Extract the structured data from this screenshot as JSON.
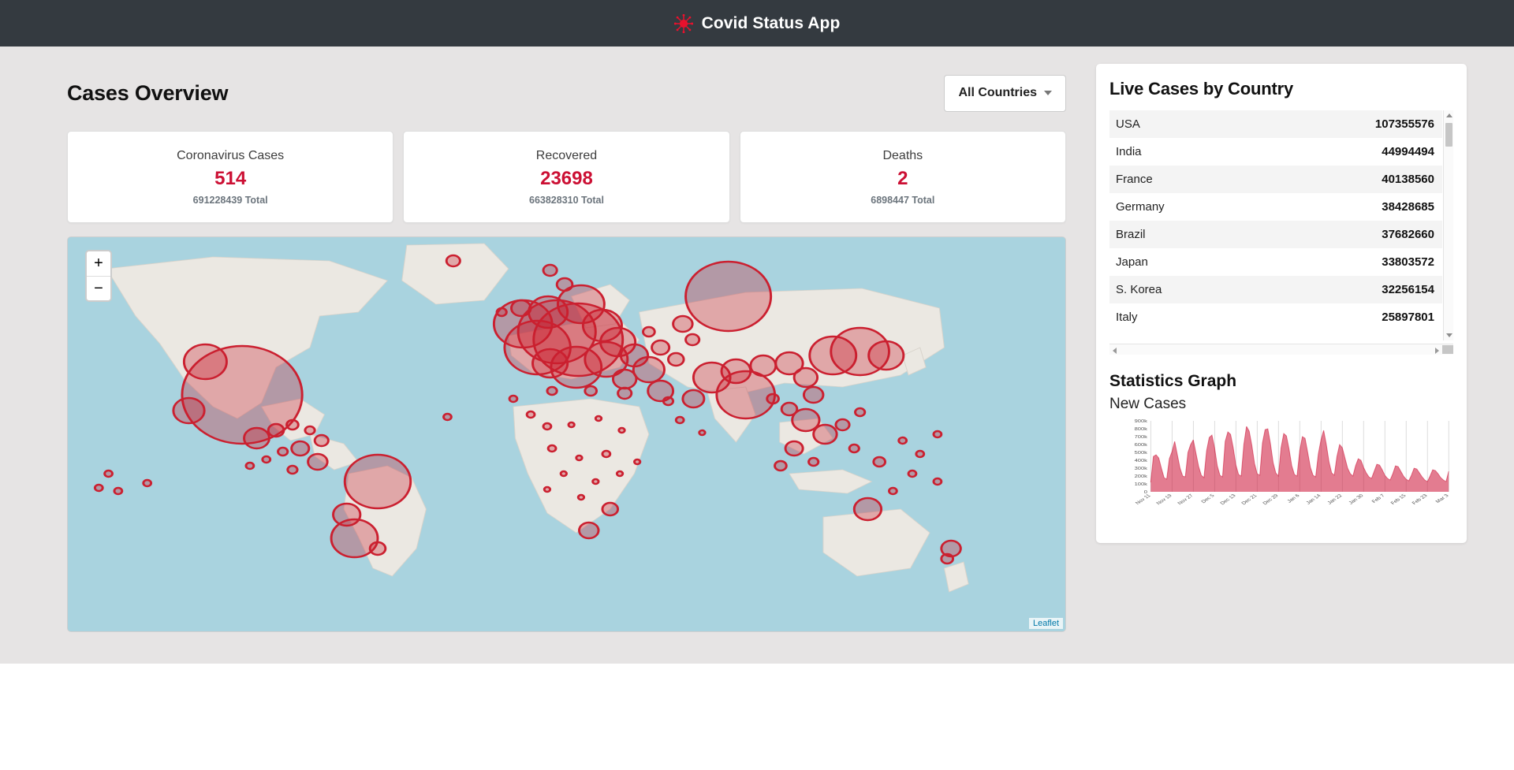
{
  "header": {
    "title": "Covid Status App",
    "icon": "virus-icon",
    "bg_color": "#343a40"
  },
  "overview": {
    "page_title": "Cases Overview",
    "country_dropdown": {
      "selected": "All Countries",
      "icon": "chevron-down-icon"
    },
    "stats": [
      {
        "label": "Coronavirus Cases",
        "value": "514",
        "total": "691228439 Total"
      },
      {
        "label": "Recovered",
        "value": "23698",
        "total": "663828310 Total"
      },
      {
        "label": "Deaths",
        "value": "2",
        "total": "6898447 Total"
      }
    ],
    "accent_color": "#cc1034"
  },
  "map": {
    "zoom_in_label": "+",
    "zoom_out_label": "−",
    "attribution": "Leaflet",
    "water_color": "#a9d3df",
    "land_color": "#ebe8e2",
    "marker_stroke": "#cb2030",
    "marker_fill": "#cb2030"
  },
  "sidebar": {
    "live_cases_title": "Live Cases by Country",
    "countries": [
      {
        "name": "USA",
        "cases": "107355576"
      },
      {
        "name": "India",
        "cases": "44994494"
      },
      {
        "name": "France",
        "cases": "40138560"
      },
      {
        "name": "Germany",
        "cases": "38428685"
      },
      {
        "name": "Brazil",
        "cases": "37682660"
      },
      {
        "name": "Japan",
        "cases": "33803572"
      },
      {
        "name": "S. Korea",
        "cases": "32256154"
      },
      {
        "name": "Italy",
        "cases": "25897801"
      }
    ],
    "statistics_title": "Statistics Graph",
    "statistics_subtitle": "New Cases"
  },
  "chart_data": {
    "type": "area",
    "title": "Statistics Graph",
    "subtitle": "New Cases",
    "xlabel": "",
    "ylabel": "",
    "ylim": [
      0,
      900000
    ],
    "grid": true,
    "legend": false,
    "line_color": "#cc1034",
    "fill_color": "rgba(204,16,52,0.55)",
    "ytick_labels": [
      "0",
      "100k",
      "200k",
      "300k",
      "400k",
      "500k",
      "600k",
      "700k",
      "800k",
      "900k"
    ],
    "ytick_values": [
      0,
      100000,
      200000,
      300000,
      400000,
      500000,
      600000,
      700000,
      800000,
      900000
    ],
    "xtick_labels": [
      "Nov 11",
      "Nov 19",
      "Nov 27",
      "Dec 5",
      "Dec 13",
      "Dec 21",
      "Dec 29",
      "Jan 6",
      "Jan 14",
      "Jan 22",
      "Jan 30",
      "Feb 7",
      "Feb 15",
      "Feb 23",
      "Mar 3"
    ],
    "categories": [
      "Nov 11",
      "Nov 12",
      "Nov 13",
      "Nov 14",
      "Nov 15",
      "Nov 16",
      "Nov 17",
      "Nov 18",
      "Nov 19",
      "Nov 20",
      "Nov 21",
      "Nov 22",
      "Nov 23",
      "Nov 24",
      "Nov 25",
      "Nov 26",
      "Nov 27",
      "Nov 28",
      "Nov 29",
      "Nov 30",
      "Dec 1",
      "Dec 2",
      "Dec 3",
      "Dec 4",
      "Dec 5",
      "Dec 6",
      "Dec 7",
      "Dec 8",
      "Dec 9",
      "Dec 10",
      "Dec 11",
      "Dec 12",
      "Dec 13",
      "Dec 14",
      "Dec 15",
      "Dec 16",
      "Dec 17",
      "Dec 18",
      "Dec 19",
      "Dec 20",
      "Dec 21",
      "Dec 22",
      "Dec 23",
      "Dec 24",
      "Dec 25",
      "Dec 26",
      "Dec 27",
      "Dec 28",
      "Dec 29",
      "Dec 30",
      "Dec 31",
      "Jan 1",
      "Jan 2",
      "Jan 3",
      "Jan 4",
      "Jan 5",
      "Jan 6",
      "Jan 7",
      "Jan 8",
      "Jan 9",
      "Jan 10",
      "Jan 11",
      "Jan 12",
      "Jan 13",
      "Jan 14",
      "Jan 15",
      "Jan 16",
      "Jan 17",
      "Jan 18",
      "Jan 19",
      "Jan 20",
      "Jan 21",
      "Jan 22",
      "Jan 23",
      "Jan 24",
      "Jan 25",
      "Jan 26",
      "Jan 27",
      "Jan 28",
      "Jan 29",
      "Jan 30",
      "Jan 31",
      "Feb 1",
      "Feb 2",
      "Feb 3",
      "Feb 4",
      "Feb 5",
      "Feb 6",
      "Feb 7",
      "Feb 8",
      "Feb 9",
      "Feb 10",
      "Feb 11",
      "Feb 12",
      "Feb 13",
      "Feb 14",
      "Feb 15",
      "Feb 16",
      "Feb 17",
      "Feb 18",
      "Feb 19",
      "Feb 20",
      "Feb 21",
      "Feb 22",
      "Feb 23",
      "Feb 24",
      "Feb 25",
      "Feb 26",
      "Feb 27",
      "Feb 28",
      "Mar 1",
      "Mar 2",
      "Mar 3"
    ],
    "values": [
      120000,
      450000,
      470000,
      430000,
      300000,
      180000,
      160000,
      420000,
      510000,
      640000,
      470000,
      300000,
      200000,
      190000,
      500000,
      600000,
      660000,
      490000,
      320000,
      210000,
      180000,
      520000,
      690000,
      720000,
      560000,
      330000,
      210000,
      190000,
      640000,
      760000,
      730000,
      560000,
      340000,
      220000,
      200000,
      600000,
      830000,
      770000,
      590000,
      360000,
      230000,
      210000,
      620000,
      790000,
      800000,
      610000,
      370000,
      240000,
      200000,
      560000,
      740000,
      710000,
      540000,
      330000,
      220000,
      200000,
      520000,
      700000,
      680000,
      500000,
      310000,
      210000,
      190000,
      480000,
      660000,
      780000,
      600000,
      380000,
      240000,
      210000,
      450000,
      600000,
      560000,
      430000,
      300000,
      230000,
      200000,
      330000,
      420000,
      400000,
      310000,
      240000,
      190000,
      170000,
      260000,
      350000,
      340000,
      280000,
      210000,
      170000,
      150000,
      230000,
      330000,
      320000,
      260000,
      200000,
      160000,
      140000,
      210000,
      300000,
      290000,
      240000,
      190000,
      150000,
      130000,
      200000,
      280000,
      270000,
      230000,
      180000,
      150000,
      130000,
      260000
    ]
  }
}
